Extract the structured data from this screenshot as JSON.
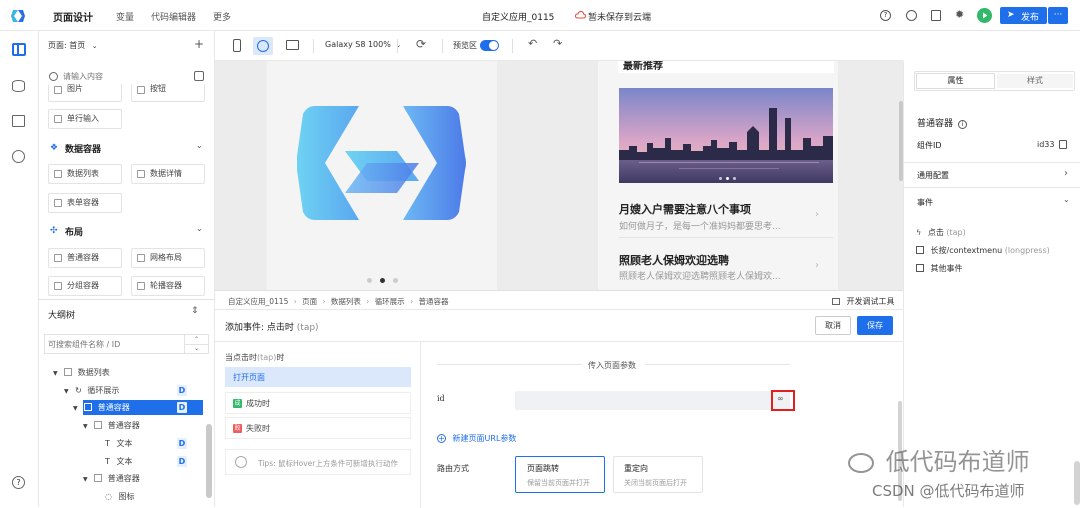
{
  "topbar": {
    "page_design": "页面设计",
    "variables": "变量",
    "code_editor": "代码编辑器",
    "more": "更多",
    "app_title": "自定义应用_0115",
    "cloud_status": "暂未保存到云端",
    "publish": "发布",
    "more_actions": "···"
  },
  "left": {
    "page_label": "页面: 首页",
    "add": "+",
    "search_placeholder": "请输入内容",
    "partial_items": [
      "图片",
      "按钮"
    ],
    "single_input": "单行输入",
    "data_container_title": "数据容器",
    "data_list": "数据列表",
    "data_detail": "数据详情",
    "form_container": "表单容器",
    "layout_title": "布局",
    "normal_container": "普通容器",
    "grid_layout": "网格布局",
    "grouped_container": "分组容器",
    "carousel_container": "轮播容器",
    "outline_title": "大纲树",
    "outline_search_placeholder": "可搜索组件名称 / ID",
    "tree": [
      {
        "label": "数据列表",
        "badge": ""
      },
      {
        "label": "循环展示",
        "badge": "D"
      },
      {
        "label": "普通容器",
        "badge": "D"
      },
      {
        "label": "普通容器",
        "badge": ""
      },
      {
        "label": "文本",
        "badge": "D"
      },
      {
        "label": "文本",
        "badge": "D"
      },
      {
        "label": "普通容器",
        "badge": ""
      },
      {
        "label": "图标",
        "badge": ""
      }
    ]
  },
  "canvasbar": {
    "device": "Galaxy S8 100%",
    "preview_label": "预览区"
  },
  "canvas": {
    "news_header": "最新推荐",
    "articles": [
      {
        "title": "月嫂入户需要注意八个事项",
        "sub": "如何做月子，是每一个准妈妈都要思考..."
      },
      {
        "title": "照顾老人保姆欢迎选聘",
        "sub": "照顾老人保姆欢迎选聘照顾老人保姆欢..."
      }
    ]
  },
  "event": {
    "breadcrumb": [
      "自定义应用_0115",
      "页面",
      "数据列表",
      "循环展示",
      "普通容器"
    ],
    "devtools": "开发调试工具",
    "title_prefix": "添加事件: 点击时",
    "title_suffix": "(tap)",
    "cancel": "取消",
    "save": "保存",
    "when_prefix": "当点击时",
    "when_paren": "(tap)",
    "when_suffix": "时",
    "open_page": "打开页面",
    "success_badge": "成",
    "success": "成功时",
    "fail_badge": "败",
    "fail": "失败时",
    "tip": "Tips: 鼠标Hover上方条件可新增执行动作",
    "params_title": "传入页面参数",
    "param_name": "id",
    "add_param": "新建页面URL参数",
    "route_label": "路由方式",
    "route_options": [
      {
        "title": "页面跳转",
        "desc": "保留当前页面并打开"
      },
      {
        "title": "重定向",
        "desc": "关闭当前页面后打开"
      }
    ]
  },
  "right": {
    "tab_props": "属性",
    "tab_style": "样式",
    "component_name": "普通容器",
    "component_id_label": "组件ID",
    "component_id": "id33",
    "general_config": "通用配置",
    "events": "事件",
    "event_items": [
      {
        "label": "点击",
        "paren": "(tap)"
      },
      {
        "label": "长按/contextmenu",
        "paren": "(longpress)"
      },
      {
        "label": "其他事件",
        "paren": ""
      }
    ]
  },
  "watermark": {
    "wechat": "低代码布道师",
    "csdn": "CSDN @低代码布道师"
  },
  "colors": {
    "accent": "#1f6feb",
    "selected_bg": "#dbe7fb",
    "tree_selected": "#1f6feb",
    "success_green": "#2fb969",
    "fail_red": "#f25b5b",
    "highlight_red": "#e02020"
  }
}
